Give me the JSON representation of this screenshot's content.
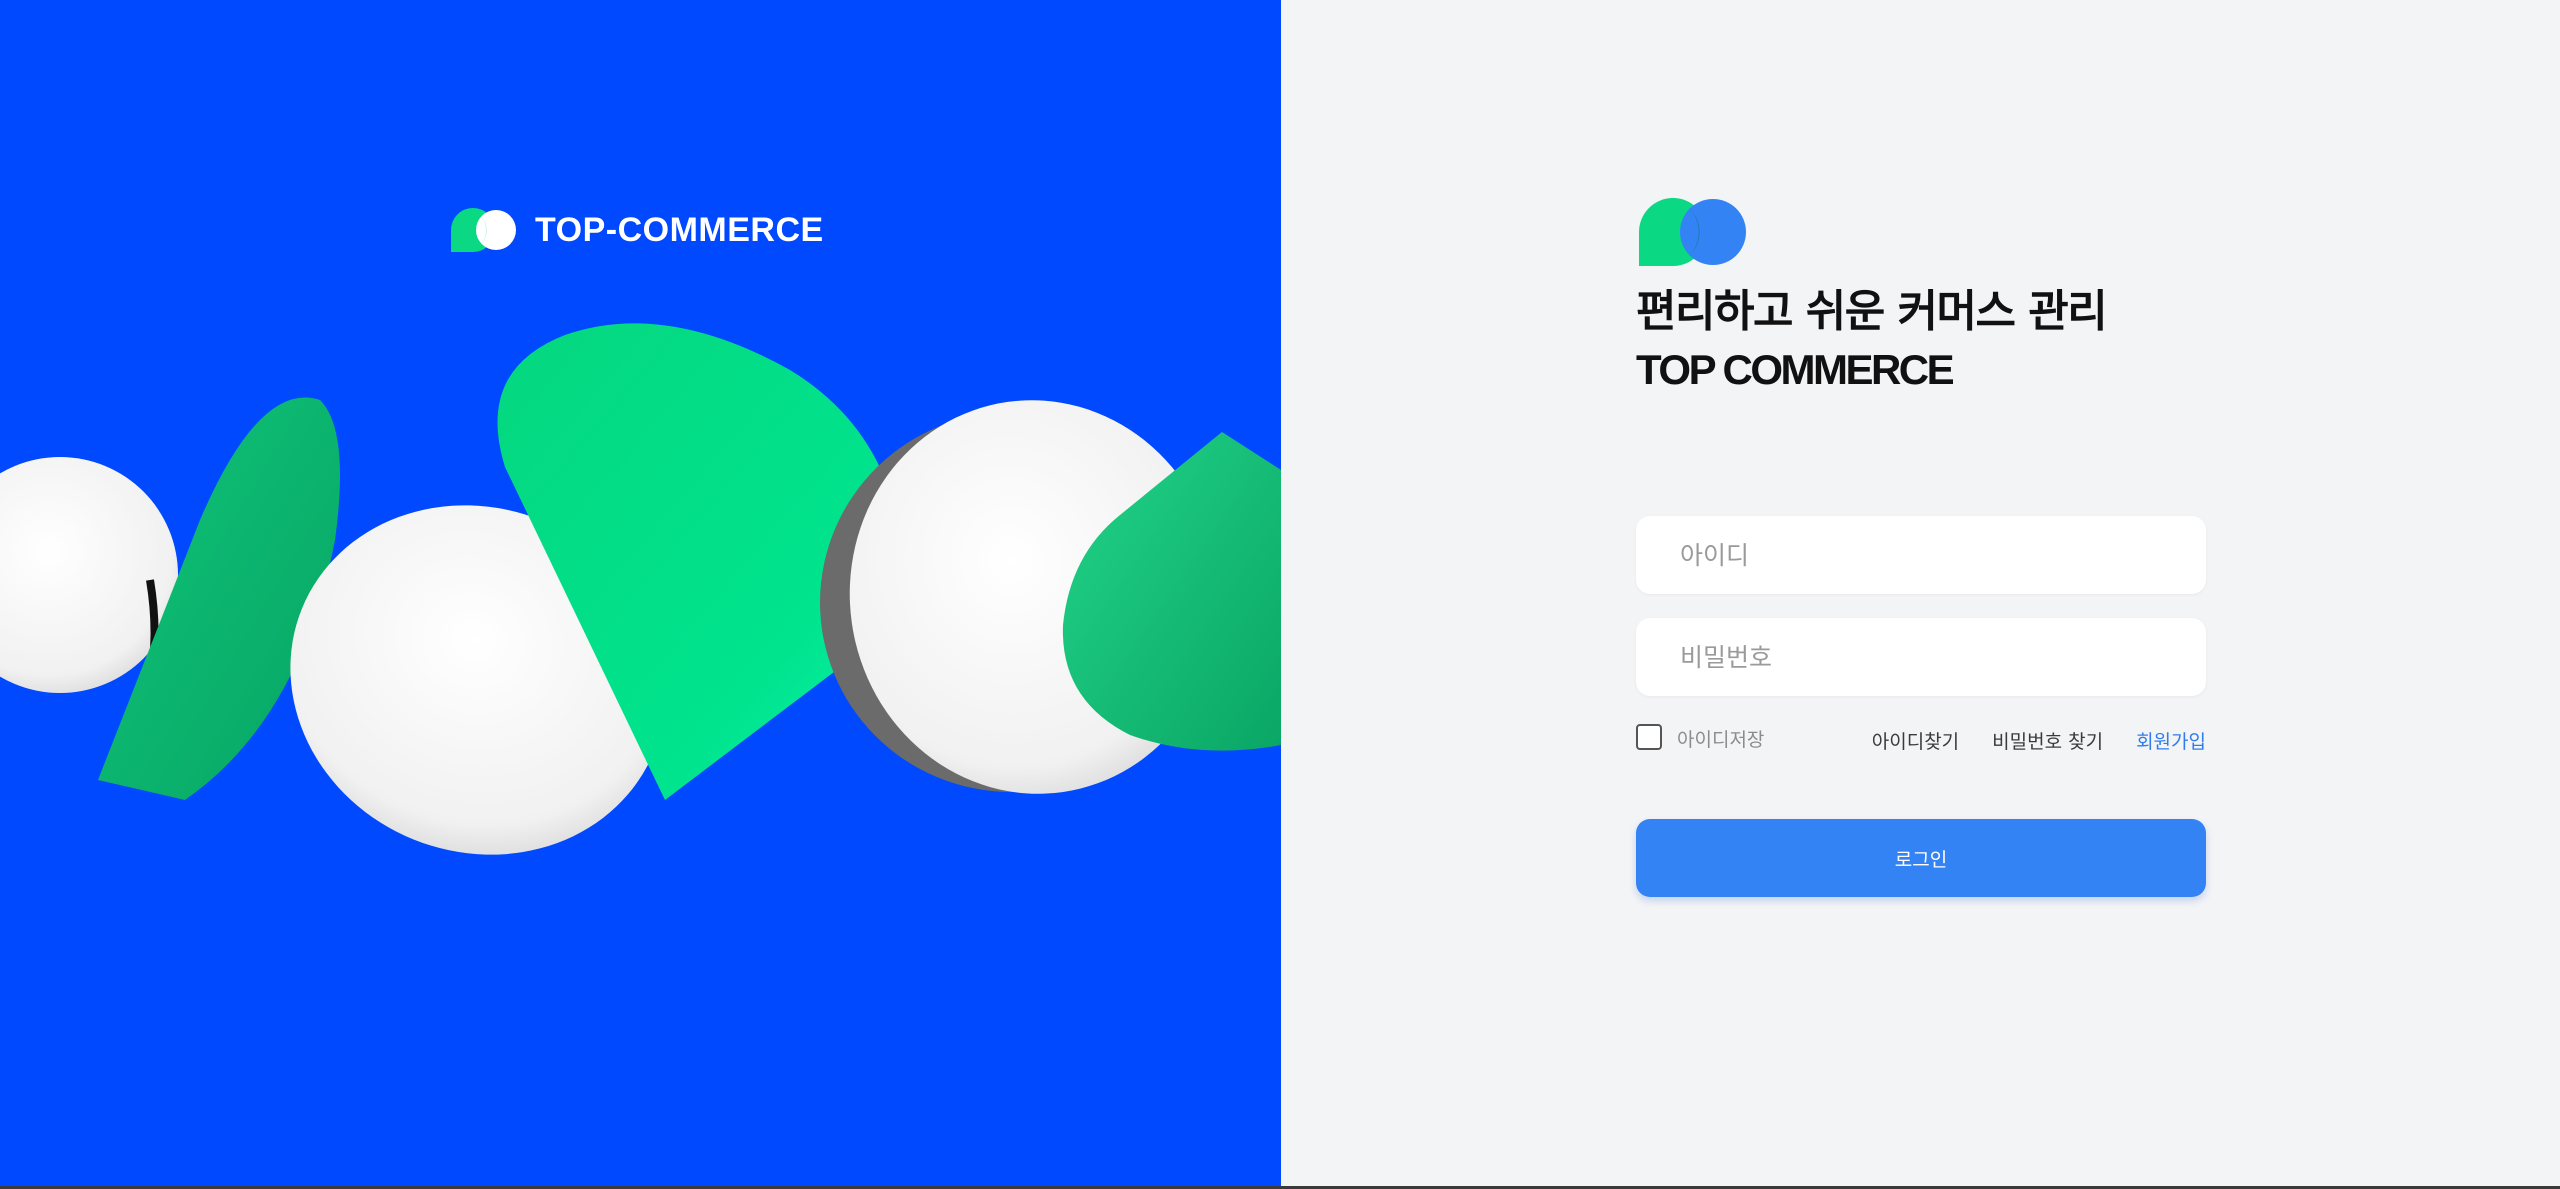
{
  "brand": {
    "name": "TOP-COMMERCE"
  },
  "headline": {
    "line1": "편리하고 쉬운 커머스 관리",
    "line2": "TOP COMMERCE"
  },
  "login": {
    "id_placeholder": "아이디",
    "password_placeholder": "비밀번호",
    "remember_label": "아이디저장",
    "find_id_label": "아이디찾기",
    "find_password_label": "비밀번호 찾기",
    "signup_label": "회원가입",
    "submit_label": "로그인"
  },
  "colors": {
    "hero_background": "#0049fe",
    "accent_blue": "#3483f5",
    "mint_green": "#0bd883",
    "link_blue": "#2f7cf0"
  },
  "icons": {
    "logo": "two-speech-bubbles-logo-icon",
    "hero": "3d-bubble-shapes-illustration"
  }
}
